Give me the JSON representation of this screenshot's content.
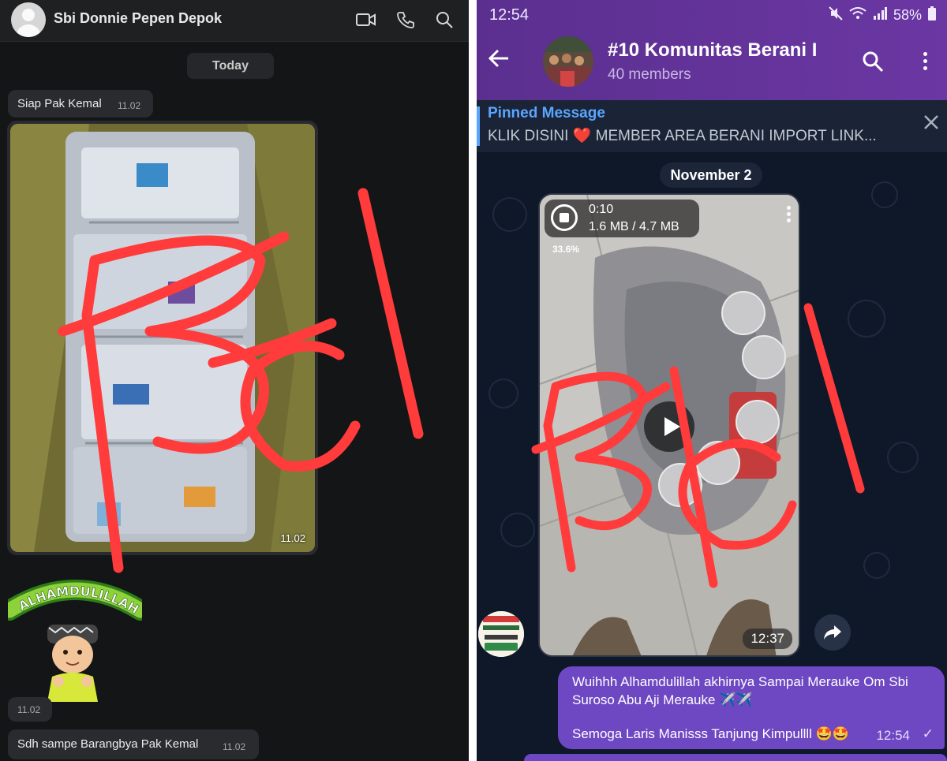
{
  "whatsapp": {
    "contact_name": "Sbi Donnie Pepen Depok",
    "date_label": "Today",
    "messages": [
      {
        "text": "Siap Pak Kemal",
        "time": "11.02"
      },
      {
        "type": "image",
        "time": "11.02"
      },
      {
        "type": "sticker",
        "caption": "ALHAMDULILLAH",
        "time": "11.02"
      },
      {
        "text": "Sdh sampe Barangbya Pak Kemal",
        "time": "11.02"
      }
    ],
    "icons": [
      "video-call-icon",
      "phone-icon",
      "search-icon"
    ]
  },
  "telegram": {
    "status_time": "12:54",
    "battery": "58%",
    "chat_title": "#10 Komunitas Berani I",
    "members": "40 members",
    "pinned_label": "Pinned Message",
    "pinned_text": "KLIK DISINI ❤️  MEMBER AREA BERANI IMPORT LINK...",
    "date_label": "November 2",
    "video": {
      "duration": "0:10",
      "size": "1.6 MB / 4.7 MB",
      "progress": "33.6%",
      "time": "12:37"
    },
    "outgoing": {
      "line1": "Wuihhh Alhamdulillah akhirnya Sampai Merauke Om Sbi",
      "line2": "Suroso Abu Aji Merauke ✈️✈️",
      "line3": "Semoga Laris Manisss Tanjung Kimpullll 🤩🤩",
      "time": "12:54",
      "status": "✓"
    }
  },
  "watermark": "BEI",
  "colors": {
    "wa_bg": "#141517",
    "tg_header": "#6b37a3",
    "tg_bubble": "#6e47c2",
    "watermark": "#ff3b3b",
    "link": "#5aa6ff"
  }
}
